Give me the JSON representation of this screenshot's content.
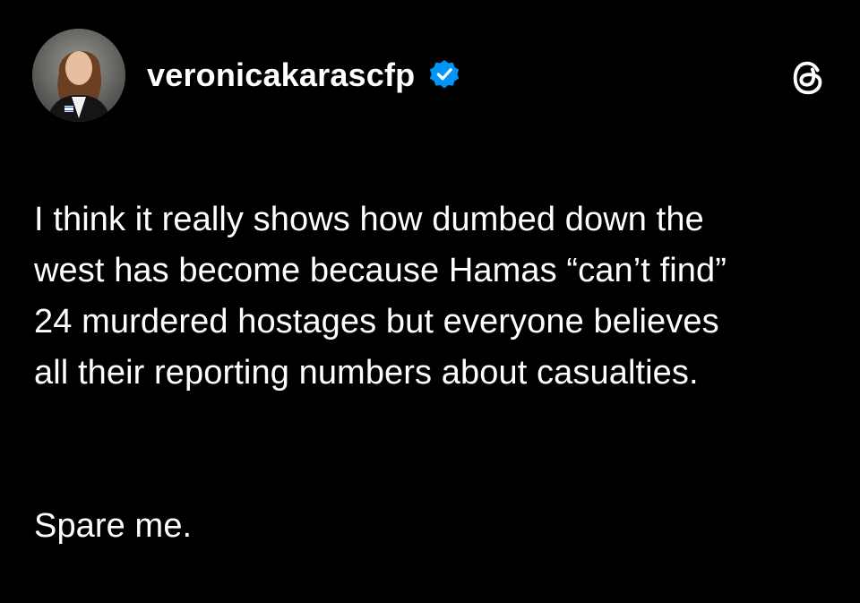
{
  "post": {
    "author": {
      "username": "veronicakarascfp",
      "verified": true,
      "avatar_icon": "profile-photo"
    },
    "app_icon": "threads-logo-icon",
    "body_paragraphs": [
      "I think it really shows how dumbed down the\nwest has become because Hamas “can’t find”\n24 murdered hostages but everyone believes\nall their reporting numbers about casualties.",
      "Spare me."
    ]
  },
  "colors": {
    "background": "#000000",
    "text": "#ffffff",
    "verified_badge": "#0095F6"
  }
}
